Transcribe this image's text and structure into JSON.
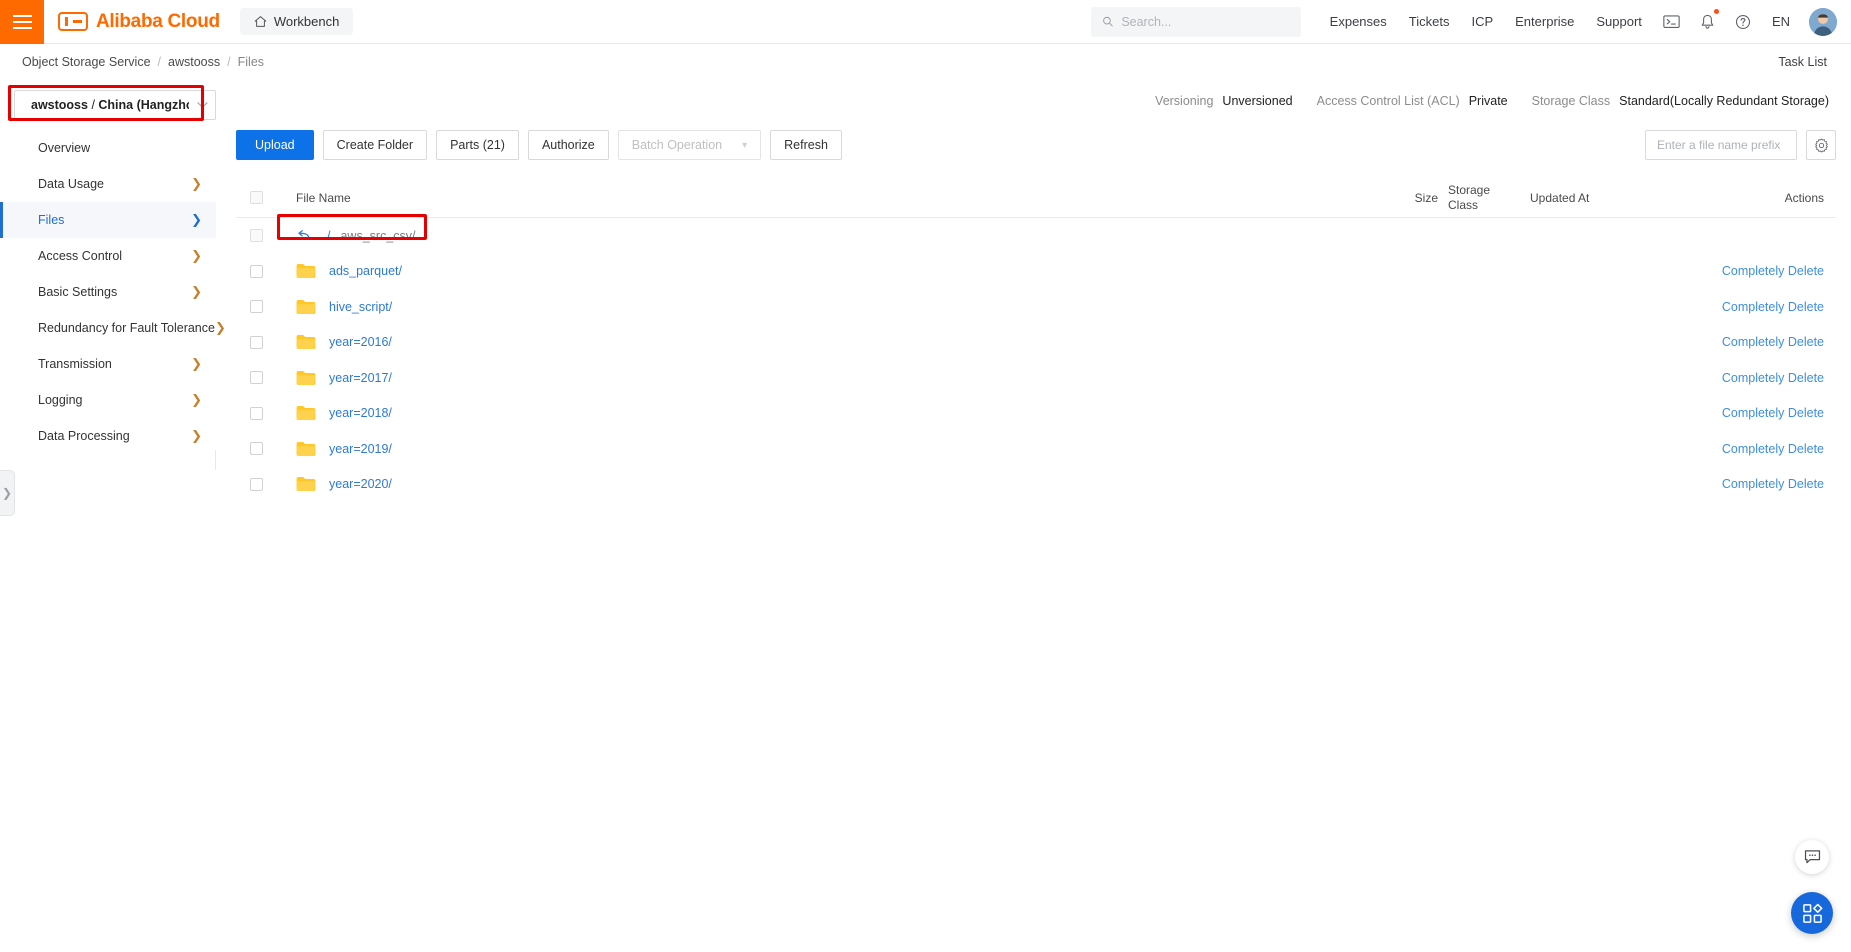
{
  "header": {
    "hamburger_icon": "hamburger-menu-icon",
    "logo_text": "Alibaba Cloud",
    "workbench_label": "Workbench",
    "workbench_icon": "home-icon",
    "search_placeholder": "Search...",
    "search_value": "",
    "search_icon": "search-icon",
    "links": [
      "Expenses",
      "Tickets",
      "ICP",
      "Enterprise",
      "Support"
    ],
    "icons": [
      {
        "name": "terminal-icon",
        "has_badge": false
      },
      {
        "name": "bell-icon",
        "has_badge": true
      },
      {
        "name": "help-circle-icon",
        "has_badge": false
      }
    ],
    "language": "EN",
    "avatar_name": "user-avatar"
  },
  "breadcrumb": {
    "items": [
      "Object Storage Service",
      "awstooss",
      "Files"
    ],
    "separator": "/",
    "task_list_label": "Task List"
  },
  "bucket_selector": {
    "bucket_name": "awstooss",
    "separator": "/",
    "region": "China (Hangzhou)",
    "caret_icon": "chevron-down-icon",
    "highlighted": true
  },
  "sidebar": {
    "items": [
      {
        "label": "Overview",
        "has_chevron": false,
        "active": false
      },
      {
        "label": "Data Usage",
        "has_chevron": true,
        "active": false
      },
      {
        "label": "Files",
        "has_chevron": true,
        "active": true
      },
      {
        "label": "Access Control",
        "has_chevron": true,
        "active": false
      },
      {
        "label": "Basic Settings",
        "has_chevron": true,
        "active": false
      },
      {
        "label": "Redundancy for Fault Tolerance",
        "has_chevron": true,
        "active": false
      },
      {
        "label": "Transmission",
        "has_chevron": true,
        "active": false
      },
      {
        "label": "Logging",
        "has_chevron": true,
        "active": false
      },
      {
        "label": "Data Processing",
        "has_chevron": true,
        "active": false
      }
    ],
    "collapse_icon": "chevron-right-icon"
  },
  "meta": [
    {
      "label": "Versioning",
      "value": "Unversioned"
    },
    {
      "label": "Access Control List (ACL)",
      "value": "Private"
    },
    {
      "label": "Storage Class",
      "value": "Standard(Locally Redundant Storage)"
    }
  ],
  "toolbar": {
    "upload_label": "Upload",
    "create_folder_label": "Create Folder",
    "parts_label": "Parts (21)",
    "authorize_label": "Authorize",
    "batch_operation_label": "Batch Operation",
    "batch_caret_icon": "chevron-down-icon",
    "refresh_label": "Refresh",
    "file_search_placeholder": "Enter a file name prefix",
    "file_search_value": "",
    "file_search_icon": "search-icon",
    "gear_icon": "gear-icon"
  },
  "table": {
    "columns": [
      "File Name",
      "Size",
      "Storage Class",
      "Updated At",
      "Actions"
    ],
    "storage_class_line1": "Storage",
    "storage_class_line2": "Class",
    "parent_row": {
      "back_icon": "back-arrow-icon",
      "slash": "/",
      "name": "aws_src_csv/",
      "highlighted": true
    },
    "rows": [
      {
        "name": "ads_parquet/",
        "icon": "folder-icon",
        "size": "",
        "storage_class": "",
        "updated_at": "",
        "action": "Completely Delete"
      },
      {
        "name": "hive_script/",
        "icon": "folder-icon",
        "size": "",
        "storage_class": "",
        "updated_at": "",
        "action": "Completely Delete"
      },
      {
        "name": "year=2016/",
        "icon": "folder-icon",
        "size": "",
        "storage_class": "",
        "updated_at": "",
        "action": "Completely Delete"
      },
      {
        "name": "year=2017/",
        "icon": "folder-icon",
        "size": "",
        "storage_class": "",
        "updated_at": "",
        "action": "Completely Delete"
      },
      {
        "name": "year=2018/",
        "icon": "folder-icon",
        "size": "",
        "storage_class": "",
        "updated_at": "",
        "action": "Completely Delete"
      },
      {
        "name": "year=2019/",
        "icon": "folder-icon",
        "size": "",
        "storage_class": "",
        "updated_at": "",
        "action": "Completely Delete"
      },
      {
        "name": "year=2020/",
        "icon": "folder-icon",
        "size": "",
        "storage_class": "",
        "updated_at": "",
        "action": "Completely Delete"
      }
    ]
  },
  "floating": {
    "chat_icon": "chat-feedback-icon",
    "apps_icon": "apps-grid-icon"
  },
  "colors": {
    "brand_orange": "#ff6a00",
    "primary_blue": "#0d72e8",
    "link_blue": "#2d7ad6",
    "folder_yellow": "#ffc828",
    "annotation_red": "#e60000",
    "fab_blue": "#1668dc"
  }
}
